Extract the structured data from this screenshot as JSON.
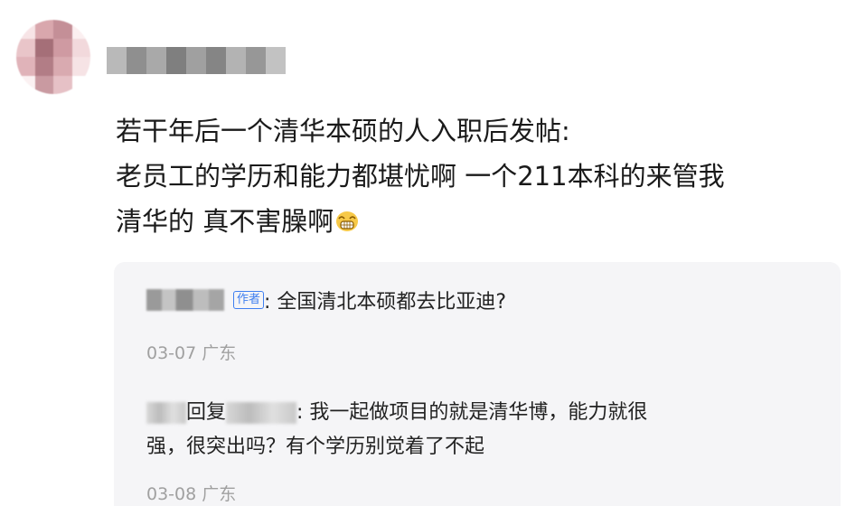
{
  "post": {
    "author_avatar_icon": "avatar-blurred",
    "author_name_redacted": true,
    "lines": [
      "若干年后一个清华本硕的人入职后发帖:",
      "老员工的学历和能力都堪忧啊 一个211本科的来管我",
      "清华的 真不害臊啊"
    ],
    "trailing_emoji": "grinning-face-emoji"
  },
  "replies": [
    {
      "author_redacted": true,
      "tag": "作者",
      "text": ": 全国清北本硕都去比亚迪?",
      "date": "03-07",
      "location": "广东"
    },
    {
      "author_redacted": true,
      "reply_word": "回复",
      "reply_to_redacted": true,
      "text_line1": ": 我一起做项目的就是清华博，能力就很",
      "text_line2": "强，很突出吗？有个学历别觉着了不起",
      "date": "03-08",
      "location": "广东"
    }
  ]
}
